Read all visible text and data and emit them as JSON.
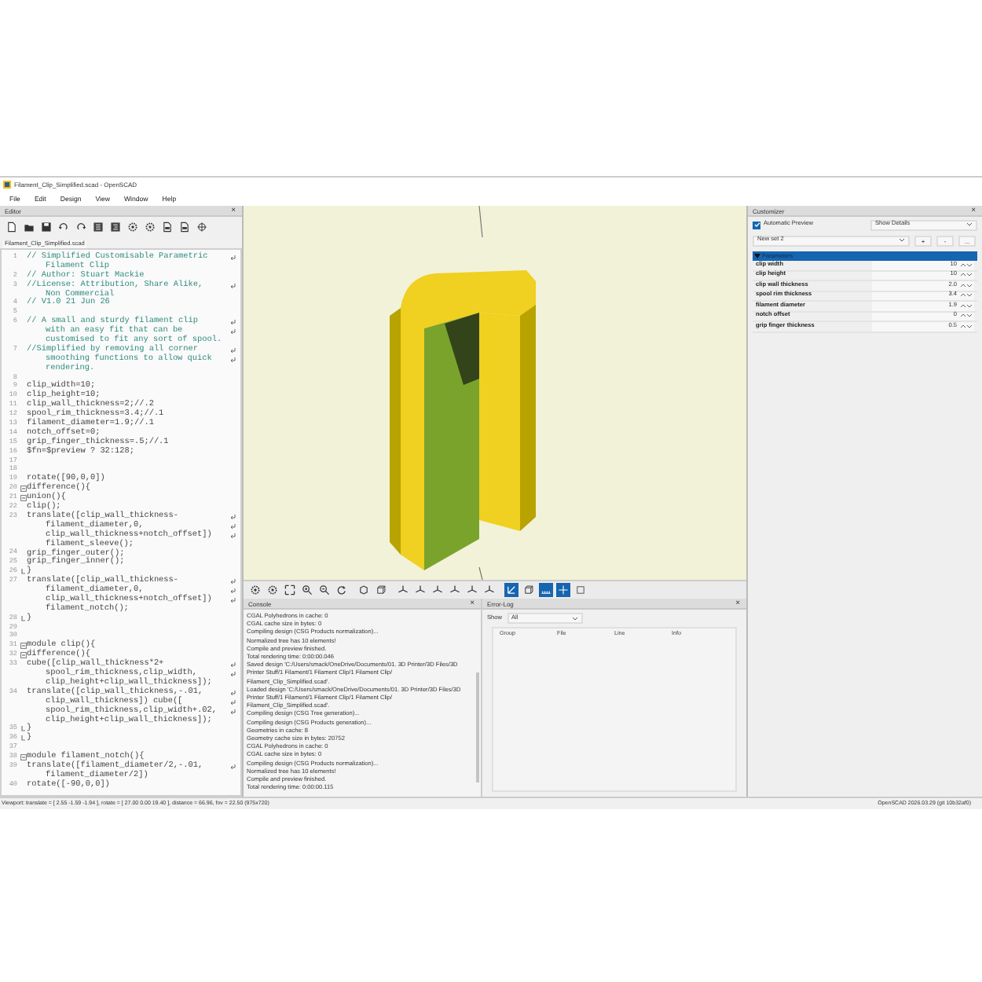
{
  "window": {
    "title": "Filament_Clip_Simplified.scad - OpenSCAD"
  },
  "menu": [
    "File",
    "Edit",
    "Design",
    "View",
    "Window",
    "Help"
  ],
  "editor": {
    "title": "Editor",
    "close": "×",
    "file_tab": "Filament_Clip_Simplified.scad",
    "toolbar": [
      {
        "kind": "new"
      },
      {
        "kind": "open"
      },
      {
        "kind": "save"
      },
      {
        "kind": "undo"
      },
      {
        "kind": "redo"
      },
      {
        "kind": "unindent"
      },
      {
        "kind": "indent"
      },
      {
        "kind": "preview"
      },
      {
        "kind": "render"
      },
      {
        "kind": "export"
      },
      {
        "kind": "export"
      },
      {
        "kind": "target"
      }
    ],
    "lines": [
      {
        "number": "1",
        "kind": "comment",
        "rows": [
          "// Simplified Customisable Parametric",
          "Filament Clip"
        ]
      },
      {
        "number": "2",
        "kind": "comment",
        "rows": [
          "// Author: Stuart Mackie"
        ]
      },
      {
        "number": "3",
        "kind": "comment",
        "rows": [
          "//License: Attribution, Share Alike,",
          "Non Commercial"
        ]
      },
      {
        "number": "4",
        "kind": "comment",
        "rows": [
          "// V1.0 21 Jun 26"
        ]
      },
      {
        "number": "5",
        "kind": "code",
        "rows": [
          ""
        ]
      },
      {
        "number": "6",
        "kind": "comment",
        "rows": [
          "// A small and sturdy filament clip",
          "with an easy fit that can be",
          "customised to fit any sort of spool."
        ]
      },
      {
        "number": "7",
        "kind": "comment",
        "rows": [
          "//Simplified by removing all corner",
          "smoothing functions to allow quick",
          "rendering."
        ]
      },
      {
        "number": "8",
        "kind": "code",
        "rows": [
          ""
        ]
      },
      {
        "number": "9",
        "kind": "code",
        "rows": [
          "clip_width=10;"
        ]
      },
      {
        "number": "10",
        "kind": "code",
        "rows": [
          "clip_height=10;"
        ]
      },
      {
        "number": "11",
        "kind": "code",
        "rows": [
          "clip_wall_thickness=2;//.2"
        ]
      },
      {
        "number": "12",
        "kind": "code",
        "rows": [
          "spool_rim_thickness=3.4;//.1"
        ]
      },
      {
        "number": "13",
        "kind": "code",
        "rows": [
          "filament_diameter=1.9;//.1"
        ]
      },
      {
        "number": "14",
        "kind": "code",
        "rows": [
          "notch_offset=0;"
        ]
      },
      {
        "number": "15",
        "kind": "code",
        "rows": [
          "grip_finger_thickness=.5;//.1"
        ]
      },
      {
        "number": "16",
        "kind": "code",
        "rows": [
          "$fn=$preview ? 32:128;"
        ]
      },
      {
        "number": "17",
        "kind": "code",
        "rows": [
          ""
        ]
      },
      {
        "number": "18",
        "kind": "code",
        "rows": [
          ""
        ]
      },
      {
        "number": "19",
        "kind": "code",
        "rows": [
          "rotate([90,0,0])"
        ]
      },
      {
        "number": "20",
        "kind": "code",
        "foldable": true,
        "rows": [
          "difference(){"
        ]
      },
      {
        "number": "21",
        "kind": "code",
        "foldable": true,
        "rows": [
          "union(){"
        ]
      },
      {
        "number": "22",
        "kind": "code",
        "rows": [
          "clip();"
        ]
      },
      {
        "number": "23",
        "kind": "code",
        "rows": [
          "translate([clip_wall_thickness-",
          "filament_diameter,0,",
          "clip_wall_thickness+notch_offset])",
          "filament_sleeve();"
        ]
      },
      {
        "number": "24",
        "kind": "code",
        "rows": [
          "grip_finger_outer();"
        ]
      },
      {
        "number": "25",
        "kind": "code",
        "rows": [
          "grip_finger_inner();"
        ]
      },
      {
        "number": "26",
        "kind": "code",
        "fold_end": true,
        "rows": [
          "}"
        ]
      },
      {
        "number": "27",
        "kind": "code",
        "rows": [
          "translate([clip_wall_thickness-",
          "filament_diameter,0,",
          "clip_wall_thickness+notch_offset])",
          "filament_notch();"
        ]
      },
      {
        "number": "28",
        "kind": "code",
        "fold_end": true,
        "rows": [
          "}"
        ]
      },
      {
        "number": "29",
        "kind": "code",
        "rows": [
          ""
        ]
      },
      {
        "number": "30",
        "kind": "code",
        "rows": [
          ""
        ]
      },
      {
        "number": "31",
        "kind": "code",
        "foldable": true,
        "rows": [
          "module clip(){"
        ]
      },
      {
        "number": "32",
        "kind": "code",
        "foldable": true,
        "rows": [
          "difference(){"
        ]
      },
      {
        "number": "33",
        "kind": "code",
        "rows": [
          "cube([clip_wall_thickness*2+",
          "spool_rim_thickness,clip_width,",
          "clip_height+clip_wall_thickness]);"
        ]
      },
      {
        "number": "34",
        "kind": "code",
        "rows": [
          "translate([clip_wall_thickness,-.01,",
          "clip_wall_thickness]) cube([",
          "spool_rim_thickness,clip_width+.02,",
          "clip_height+clip_wall_thickness]);"
        ]
      },
      {
        "number": "35",
        "kind": "code",
        "fold_end": true,
        "rows": [
          "}"
        ]
      },
      {
        "number": "36",
        "kind": "code",
        "fold_end": true,
        "rows": [
          "}"
        ]
      },
      {
        "number": "37",
        "kind": "code",
        "rows": [
          ""
        ]
      },
      {
        "number": "38",
        "kind": "code",
        "foldable": true,
        "rows": [
          "module filament_notch(){"
        ]
      },
      {
        "number": "39",
        "kind": "code",
        "rows": [
          "translate([filament_diameter/2,-.01,",
          "filament_diameter/2])"
        ]
      },
      {
        "number": "40",
        "kind": "code",
        "rows": [
          "rotate([-90,0,0])"
        ]
      }
    ]
  },
  "view_toolbar": [
    {
      "kind": "preview",
      "on": false
    },
    {
      "kind": "render",
      "on": false
    },
    {
      "kind": "view_all",
      "on": false
    },
    {
      "kind": "zoom_in",
      "on": false
    },
    {
      "kind": "zoom_out",
      "on": false
    },
    {
      "kind": "reset",
      "on": false
    },
    {
      "kind": "perspective",
      "on": false
    },
    {
      "kind": "orthographic",
      "on": false
    },
    {
      "kind": "view_axis",
      "on": false
    },
    {
      "kind": "view_axis",
      "on": false
    },
    {
      "kind": "view_axis",
      "on": false
    },
    {
      "kind": "view_axis",
      "on": false
    },
    {
      "kind": "view_axis",
      "on": false
    },
    {
      "kind": "view_axis",
      "on": false
    },
    {
      "kind": "show_axes",
      "on": true
    },
    {
      "kind": "show_edges",
      "on": false
    },
    {
      "kind": "show_scales",
      "on": true
    },
    {
      "kind": "show_crosshairs",
      "on": true
    },
    {
      "kind": "frame",
      "on": false
    }
  ],
  "console": {
    "title": "Console",
    "close": "×",
    "lines": [
      "CGAL Polyhedrons in cache: 0",
      "CGAL cache size in bytes: 0",
      "Compiling design (CSG Products normalization)...",
      "Normalized tree has 10 elements!",
      "Compile and preview finished.",
      "Total rendering time: 0:00:00.046",
      "Saved design 'C:/Users/smack/OneDrive/Documents/01. 3D Printer/3D Files/3D",
      "Printer Stuff/1 Filament/1 Filament Clip/1 Filament Clip/",
      "Filament_Clip_Simplified.scad'.",
      "Loaded design 'C:/Users/smack/OneDrive/Documents/01. 3D Printer/3D Files/3D",
      "Printer Stuff/1 Filament/1 Filament Clip/1 Filament Clip/",
      "Filament_Clip_Simplified.scad'.",
      "Compiling design (CSG Tree generation)...",
      "Compiling design (CSG Products generation)...",
      "Geometries in cache: 8",
      "Geometry cache size in bytes: 20752",
      "CGAL Polyhedrons in cache: 0",
      "CGAL cache size in bytes: 0",
      "Compiling design (CSG Products normalization)...",
      "Normalized tree has 10 elements!",
      "Compile and preview finished.",
      "Total rendering time: 0:00:00.115"
    ]
  },
  "error_log": {
    "title": "Error-Log",
    "close": "×",
    "show_label": "Show",
    "show_value": "All",
    "columns": [
      "Group",
      "File",
      "Line",
      "Info"
    ]
  },
  "customizer": {
    "title": "Customizer",
    "close": "×",
    "automatic_preview": {
      "label": "Automatic Preview",
      "checked": true
    },
    "details": "Show Details",
    "preset": "New set 2",
    "preset_buttons": [
      "+",
      "-",
      "..."
    ],
    "section": {
      "label": "Parameters",
      "expanded": true,
      "selected": true
    },
    "parameters": [
      {
        "label": "clip width",
        "value": "10"
      },
      {
        "label": "clip height",
        "value": "10"
      },
      {
        "label": "clip wall thickness",
        "value": "2.0"
      },
      {
        "label": "spool rim thickness",
        "value": "3.4"
      },
      {
        "label": "filament diameter",
        "value": "1.9"
      },
      {
        "label": "notch offset",
        "value": "0"
      },
      {
        "label": "grip finger thickness",
        "value": "0.5"
      }
    ]
  },
  "status_bar": {
    "viewport": "Viewport: translate = [ 2.55 -1.59 -1.94 ], rotate = [ 27.00 0.00 19.40 ], distance = 66.96, fov = 22.50 (975x720)",
    "version": "OpenSCAD 2026.03.29 (git 10b32af0)"
  }
}
